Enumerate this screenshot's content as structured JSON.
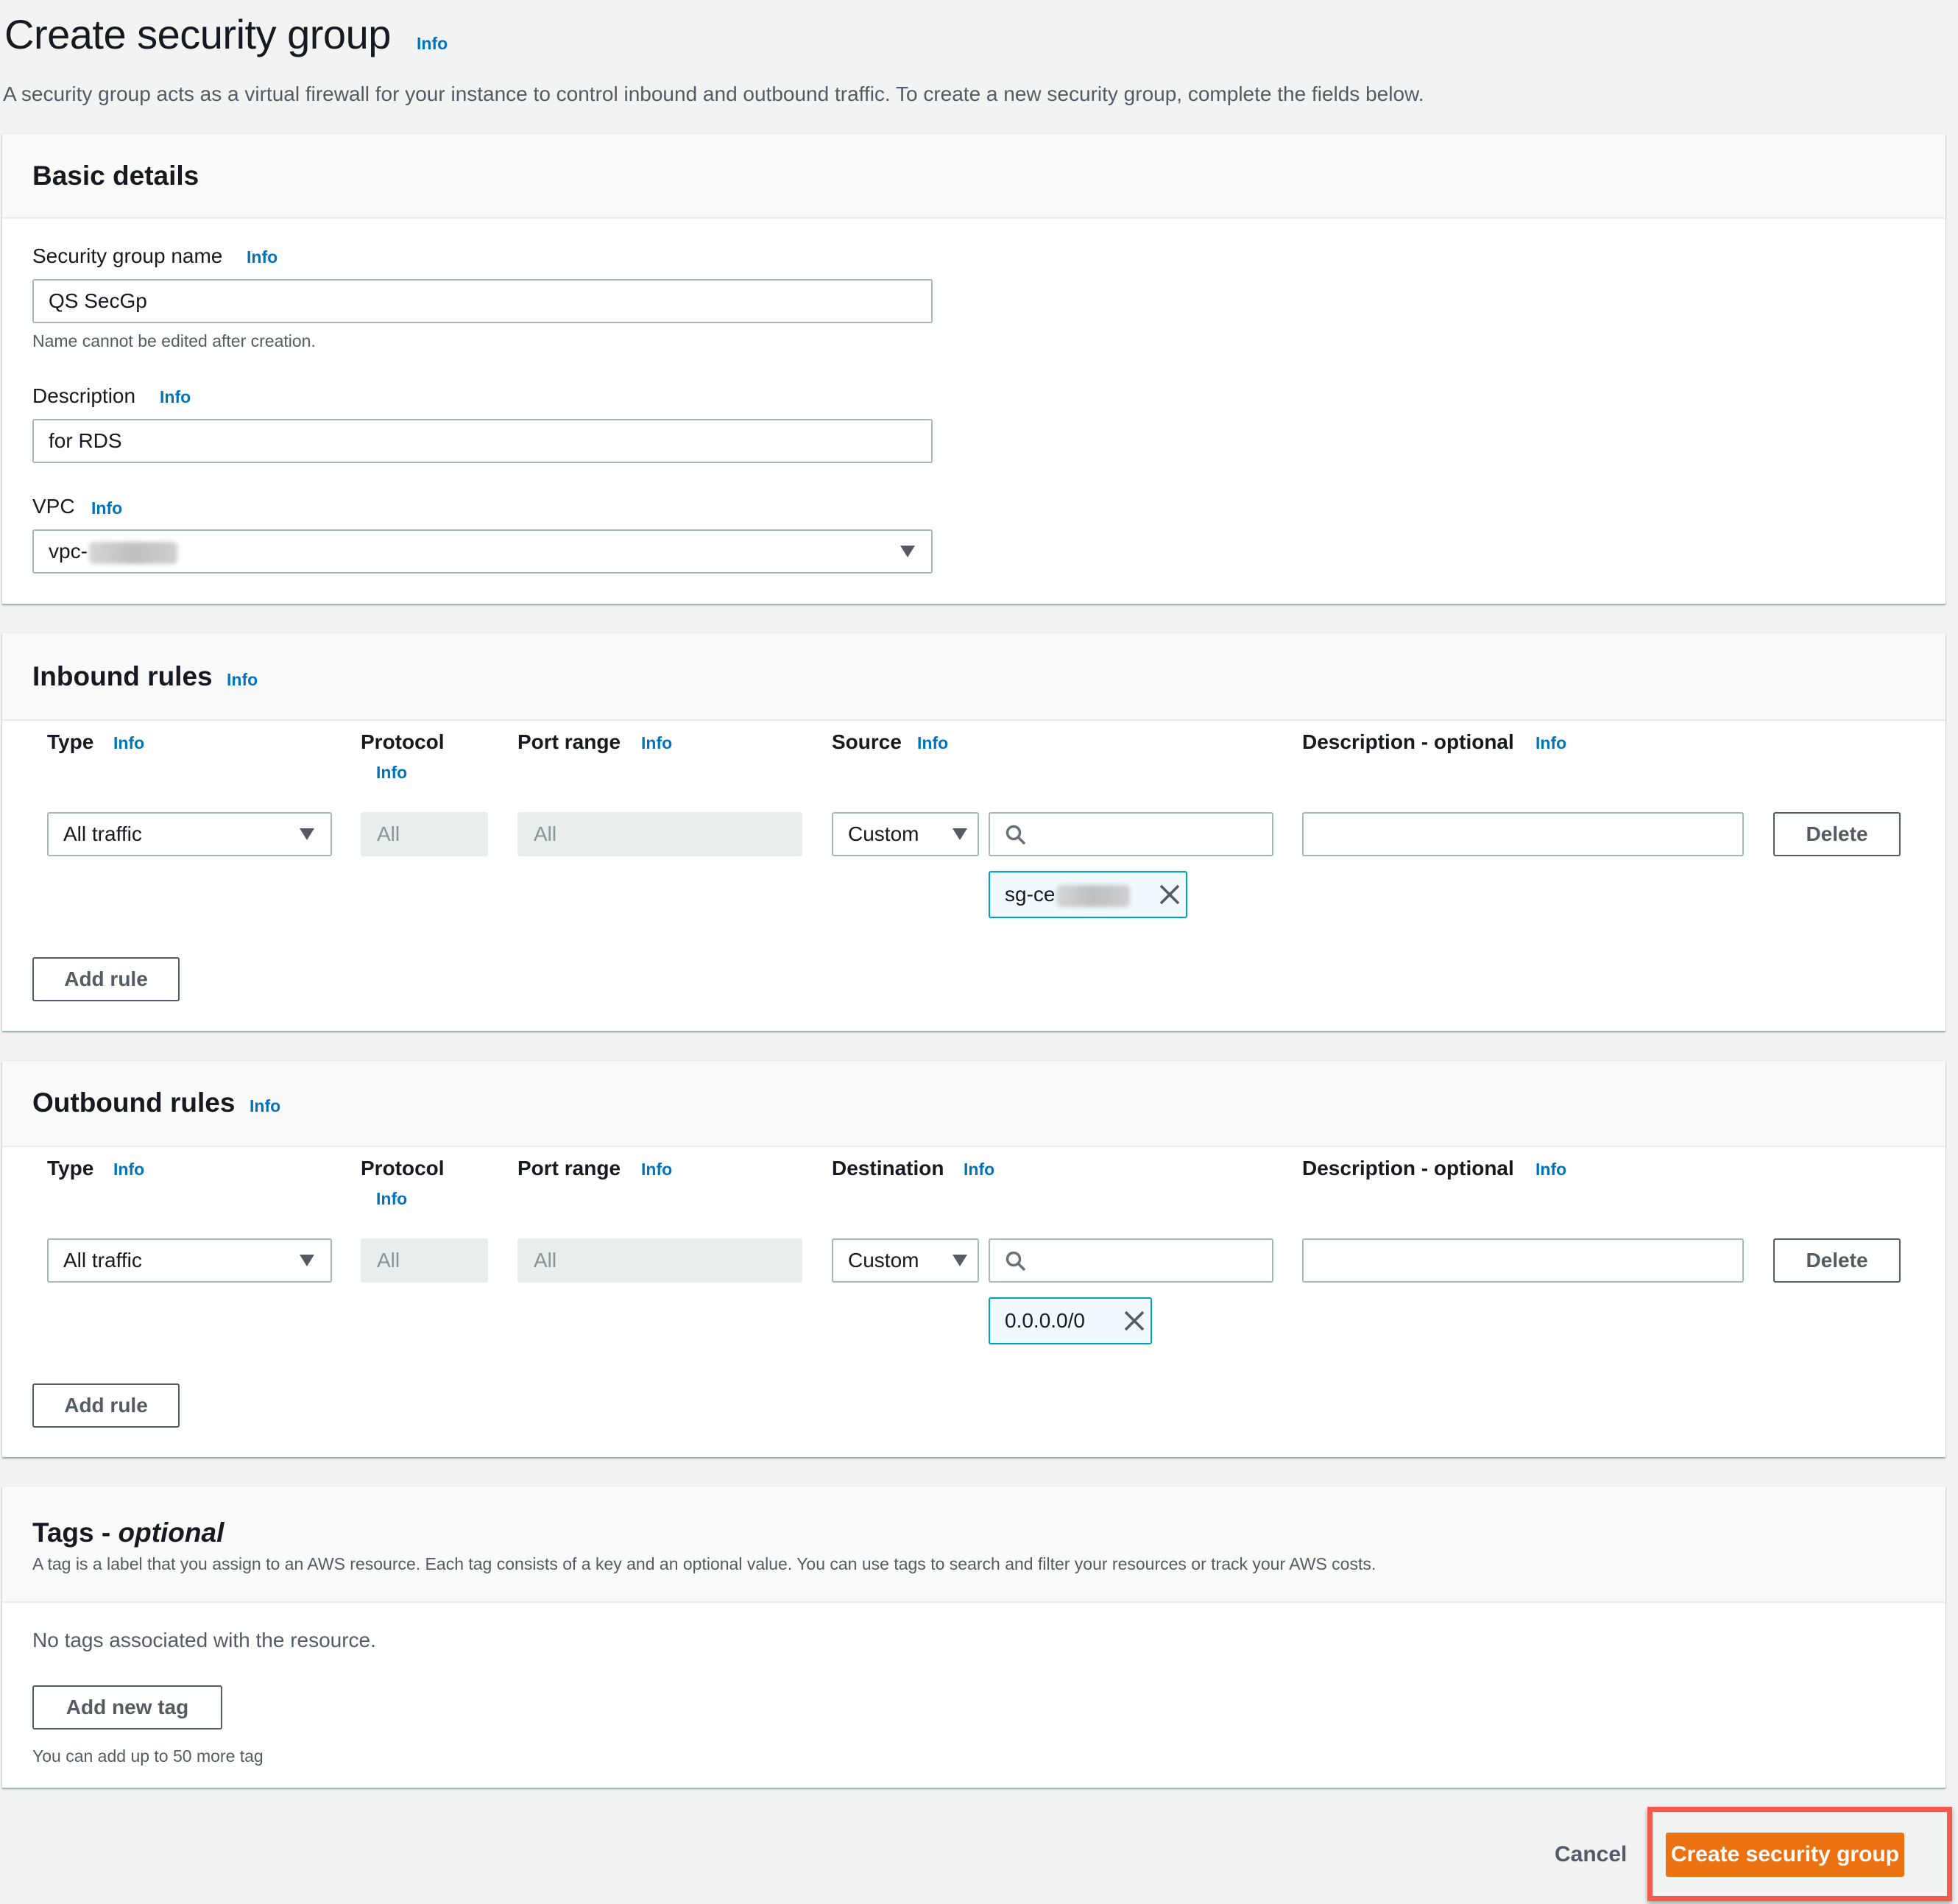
{
  "page": {
    "title": "Create security group",
    "info": "Info",
    "description": "A security group acts as a virtual firewall for your instance to control inbound and outbound traffic. To create a new security group, complete the fields below."
  },
  "basic_details": {
    "title": "Basic details",
    "name_label": "Security group name",
    "name_value": "QS SecGp",
    "name_hint": "Name cannot be edited after creation.",
    "description_label": "Description",
    "description_value": "for RDS",
    "vpc_label": "VPC",
    "vpc_value": "vpc-"
  },
  "inbound": {
    "title": "Inbound rules",
    "columns": {
      "type": "Type",
      "protocol": "Protocol",
      "port_range": "Port range",
      "source": "Source",
      "description": "Description - optional"
    },
    "rule": {
      "type": "All traffic",
      "protocol": "All",
      "port_range": "All",
      "source_type": "Custom",
      "source_search": "",
      "source_token": "sg-ce",
      "description": ""
    },
    "delete_label": "Delete",
    "add_rule_label": "Add rule"
  },
  "outbound": {
    "title": "Outbound rules",
    "columns": {
      "type": "Type",
      "protocol": "Protocol",
      "port_range": "Port range",
      "destination": "Destination",
      "description": "Description - optional"
    },
    "rule": {
      "type": "All traffic",
      "protocol": "All",
      "port_range": "All",
      "destination_type": "Custom",
      "destination_search": "",
      "destination_token": "0.0.0.0/0",
      "description": ""
    },
    "delete_label": "Delete",
    "add_rule_label": "Add rule"
  },
  "tags": {
    "title": "Tags - ",
    "title_optional": "optional",
    "description": "A tag is a label that you assign to an AWS resource. Each tag consists of a key and an optional value. You can use tags to search and filter your resources or track your AWS costs.",
    "empty_text": "No tags associated with the resource.",
    "add_tag_label": "Add new tag",
    "limit_hint": "You can add up to 50 more tag"
  },
  "footer": {
    "cancel_label": "Cancel",
    "create_label": "Create security group"
  },
  "colors": {
    "primary": "#ec7211",
    "link": "#0073bb",
    "highlight": "#f25a4e",
    "token_border": "#00a1c9"
  }
}
